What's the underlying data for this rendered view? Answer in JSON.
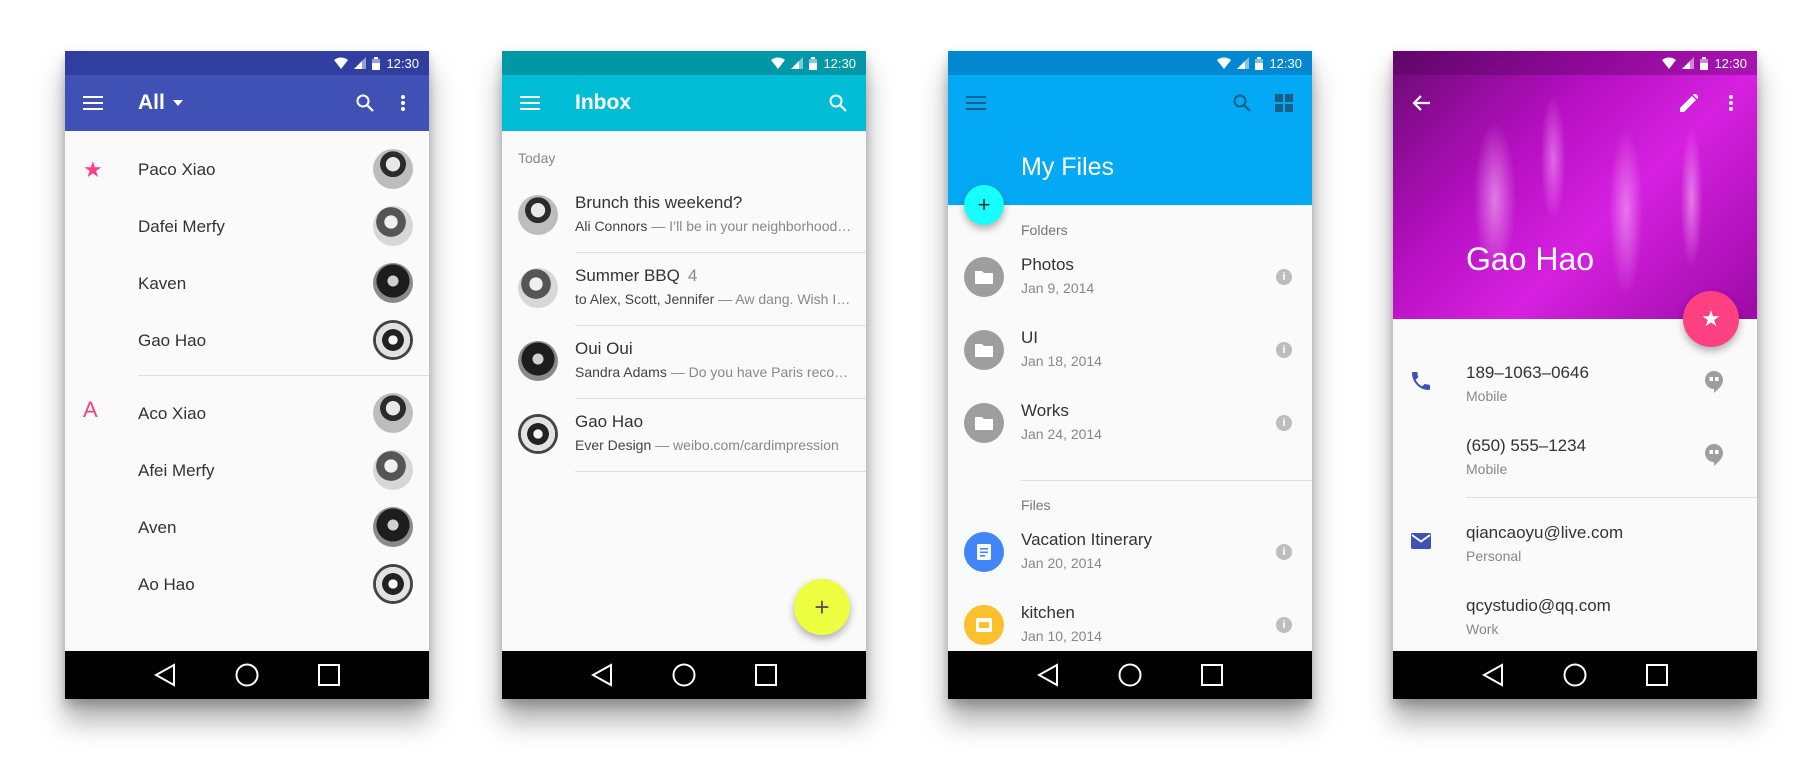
{
  "status": {
    "time": "12:30"
  },
  "contacts": {
    "title": "All",
    "groups": [
      {
        "marker": "★",
        "items": [
          "Paco Xiao",
          "Dafei Merfy",
          "Kaven",
          "Gao Hao"
        ]
      },
      {
        "marker": "A",
        "items": [
          "Aco Xiao",
          "Afei Merfy",
          "Aven",
          "Ao Hao"
        ]
      }
    ]
  },
  "inbox": {
    "title": "Inbox",
    "section": "Today",
    "messages": [
      {
        "title": "Brunch this weekend?",
        "count": "",
        "sender": "Ali Connors",
        "preview": " — I’ll be in your neighborhood doing errands this weekend"
      },
      {
        "title": "Summer BBQ",
        "count": "4",
        "sender": "to Alex, Scott, Jennifer",
        "preview": " — Aw dang. Wish I could make it"
      },
      {
        "title": "Oui Oui",
        "count": "",
        "sender": "Sandra Adams",
        "preview": " — Do you have Paris recommendations"
      },
      {
        "title": "Gao Hao",
        "count": "",
        "sender": "Ever Design",
        "preview": " — weibo.com/cardimpression"
      }
    ],
    "fab": "+"
  },
  "files": {
    "title": "My Files",
    "fab": "+",
    "folders_label": "Folders",
    "files_label": "Files",
    "folders": [
      {
        "name": "Photos",
        "date": "Jan 9, 2014"
      },
      {
        "name": "UI",
        "date": "Jan 18, 2014"
      },
      {
        "name": "Works",
        "date": "Jan 24, 2014"
      }
    ],
    "files": [
      {
        "name": "Vacation Itinerary",
        "date": "Jan 20, 2014",
        "color": "#4285f4"
      },
      {
        "name": "kitchen",
        "date": "Jan 10, 2014",
        "color": "#fbc02d"
      }
    ],
    "info": "i"
  },
  "contact_detail": {
    "name": "Gao Hao",
    "phones": [
      {
        "number": "189–1063–0646",
        "type": "Mobile"
      },
      {
        "number": "(650) 555–1234",
        "type": "Mobile"
      }
    ],
    "emails": [
      {
        "address": "qiancaoyu@live.com",
        "type": "Personal"
      },
      {
        "address": "qcystudio@qq.com",
        "type": "Work"
      }
    ],
    "fab": "★"
  },
  "colors": {
    "indigo": "#3f51b5",
    "cyan": "#00bcd4",
    "light_blue": "#03a9f4",
    "pink": "#ff4081",
    "yellow": "#eeff41",
    "aqua": "#18ffff"
  }
}
